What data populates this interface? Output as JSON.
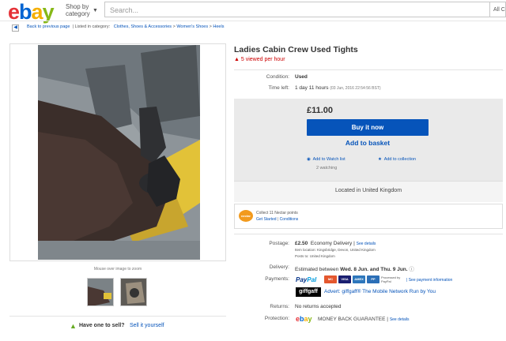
{
  "header": {
    "logo_letters": [
      "e",
      "b",
      "a",
      "y"
    ],
    "logo_colors": [
      "#e53238",
      "#0064d2",
      "#f5af02",
      "#86b817"
    ],
    "shop_by_line1": "Shop by",
    "shop_by_line2": "category",
    "search_placeholder": "Search...",
    "all_categories": "All C"
  },
  "breadcrumb": {
    "back_label": "Back to previous page",
    "listed_label": "| Listed in category:",
    "path": [
      "Clothes, Shoes & Accessories",
      ">",
      "Women's Shoes",
      ">",
      "Heels"
    ]
  },
  "gallery": {
    "hint": "Mouse over image to zoom",
    "sell_prompt": "Have one to sell?",
    "sell_link": "Sell it yourself"
  },
  "listing": {
    "title": "Ladies Cabin Crew Used Tights",
    "viewed": "5 viewed per hour",
    "condition_label": "Condition:",
    "condition_value": "Used",
    "time_left_label": "Time left:",
    "time_left_value": "1 day 11 hours",
    "time_left_date": "(03 Jun, 2016   22:54:56 BST)",
    "price": "£11.00",
    "buy_now": "Buy it now",
    "add_basket": "Add to basket",
    "watch_list": "Add to Watch list",
    "watching": "2 watching",
    "collection": "Add to collection",
    "located": "Located in United Kingdom"
  },
  "nectar": {
    "logo": "nectar",
    "line1": "Collect 11 Nectar points",
    "line2_a": "Get Started",
    "line2_sep": "|",
    "line2_b": "Conditions"
  },
  "postage": {
    "label": "Postage:",
    "price": "£2.50",
    "service": "Economy Delivery",
    "sep": "|",
    "details_link": "See details",
    "item_location": "Item location:   Kingsbridge, Devon, United Kingdom",
    "posts_to": "Posts to:    United Kingdom"
  },
  "delivery": {
    "label": "Delivery:",
    "text": "Estimated between",
    "dates": "Wed. 8 Jun. and Thu. 9 Jun."
  },
  "payments": {
    "label": "Payments:",
    "paypal_a": "Pay",
    "paypal_b": "Pal",
    "cards": [
      "MC",
      "VISA",
      "AMEX",
      "PP"
    ],
    "card_colors": [
      "#e4572e",
      "#1a1f71",
      "#2e77bc",
      "#2c6fb7"
    ],
    "processed": "Processed by PayPal",
    "payment_info_link": "See payment information",
    "giffgaff": "giffgaff",
    "advert": "Advert: giffgaff® The Mobile Network Run by You"
  },
  "returns": {
    "label": "Returns:",
    "value": "No returns accepted"
  },
  "protection": {
    "label": "Protection:",
    "brand": "ebay",
    "value": "MONEY BACK GUARANTEE",
    "sep": "|",
    "details_link": "See details"
  }
}
